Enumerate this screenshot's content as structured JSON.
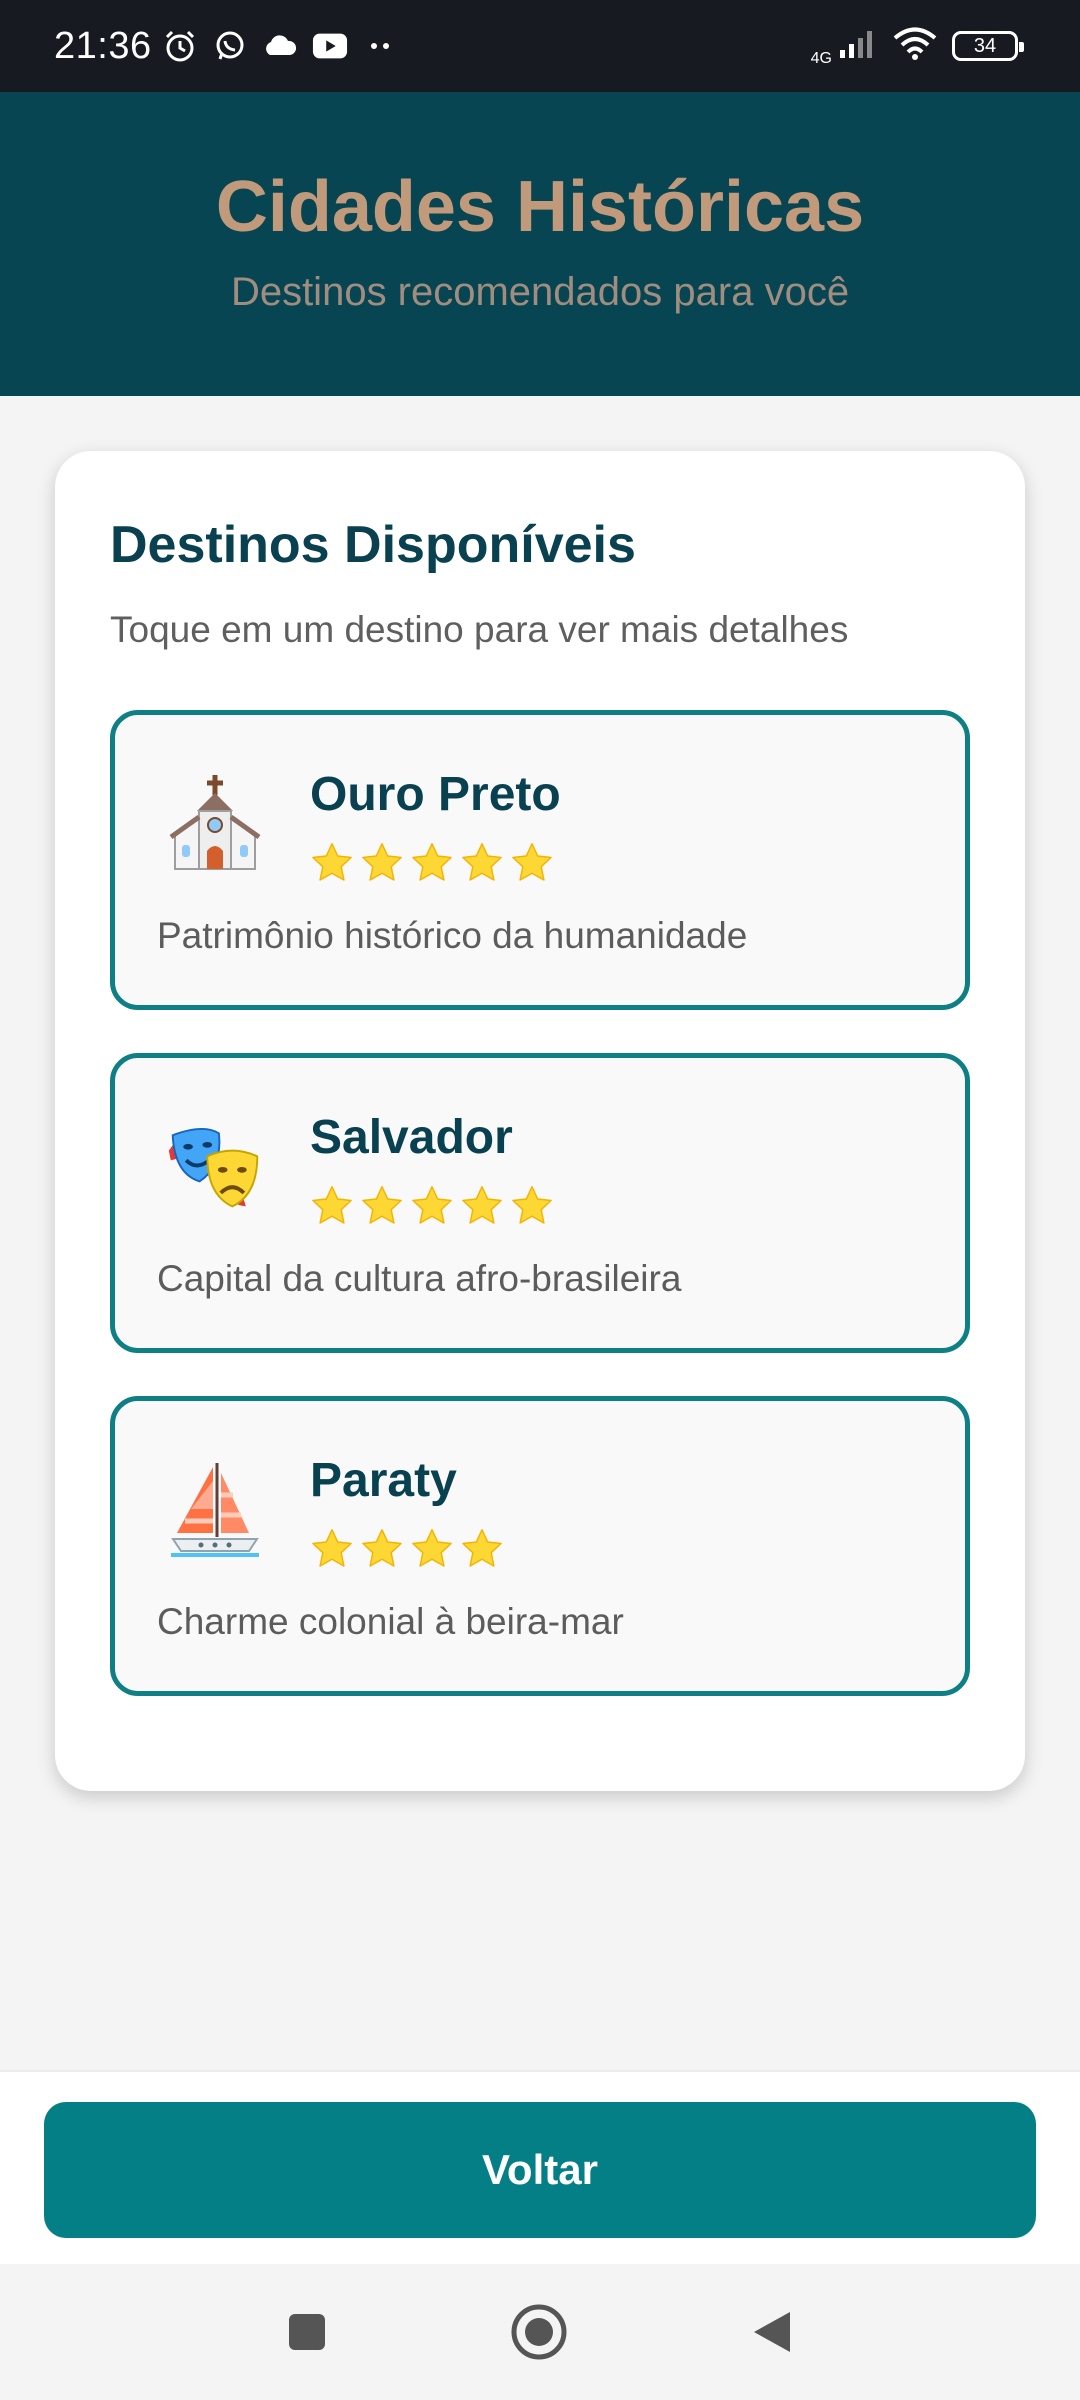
{
  "status_bar": {
    "time": "21:36",
    "left_icons": [
      "alarm-icon",
      "whatsapp-icon",
      "cloud-icon",
      "youtube-icon",
      "more-dots-icon"
    ],
    "network_label": "4G",
    "battery": "34"
  },
  "header": {
    "title": "Cidades Históricas",
    "subtitle": "Destinos recomendados para você"
  },
  "card": {
    "title": "Destinos Disponíveis",
    "subtitle": "Toque em um destino para ver mais detalhes",
    "destinations": [
      {
        "name": "Ouro Preto",
        "icon": "church-icon",
        "stars": 5,
        "description": "Patrimônio histórico da humanidade"
      },
      {
        "name": "Salvador",
        "icon": "theater-masks-icon",
        "stars": 5,
        "description": "Capital da cultura afro-brasileira"
      },
      {
        "name": "Paraty",
        "icon": "sailboat-icon",
        "stars": 4,
        "description": "Charme colonial à beira-mar"
      }
    ]
  },
  "footer": {
    "back_label": "Voltar"
  },
  "nav_bar": {
    "buttons": [
      "recents-square-icon",
      "home-circle-icon",
      "back-triangle-icon"
    ]
  },
  "colors": {
    "header_bg": "#064551",
    "header_title": "#c19a7b",
    "accent": "#057f86",
    "star": "#fdd835"
  }
}
